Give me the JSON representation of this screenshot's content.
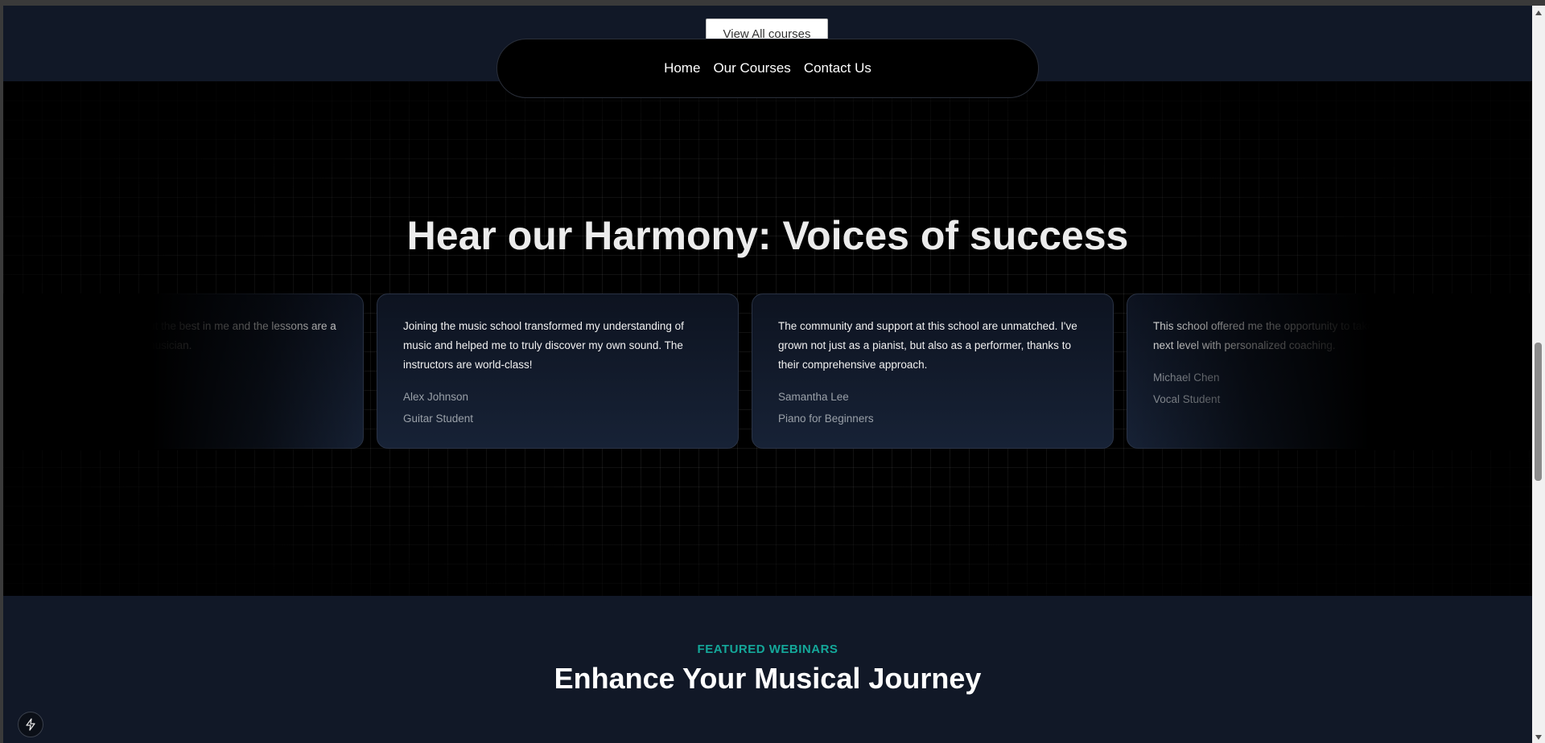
{
  "top": {
    "view_all_label": "View All courses"
  },
  "nav": {
    "items": [
      {
        "label": "Home"
      },
      {
        "label": "Our Courses"
      },
      {
        "label": "Contact Us"
      }
    ]
  },
  "testimonials": {
    "title": "Hear our Harmony: Voices of success",
    "cards": [
      {
        "quote": "Joining the music school transformed my understanding of music and helped me to truly discover my own sound. The instructors are world-class!",
        "name": "Alex Johnson",
        "role": "Guitar Student"
      },
      {
        "quote": "The community and support at this school are unmatched. I've grown not just as a pianist, but also as a performer, thanks to their comprehensive approach.",
        "name": "Samantha Lee",
        "role": "Piano for Beginners"
      },
      {
        "quote": "This school offered me the opportunity to take my singing to the next level with personalized coaching.",
        "name": "Michael Chen",
        "role": "Vocal Student"
      },
      {
        "quote": "The instructors brought out the best in me and the lessons are a great foundation for any musician.",
        "name": "",
        "role": ""
      }
    ]
  },
  "webinars": {
    "eyebrow": "FEATURED WEBINARS",
    "title": "Enhance Your Musical Journey"
  },
  "colors": {
    "page_bg": "#111827",
    "section_bg": "#000000",
    "accent_teal": "#14a89a"
  },
  "icons": {
    "floating_button": "lightning-icon"
  }
}
